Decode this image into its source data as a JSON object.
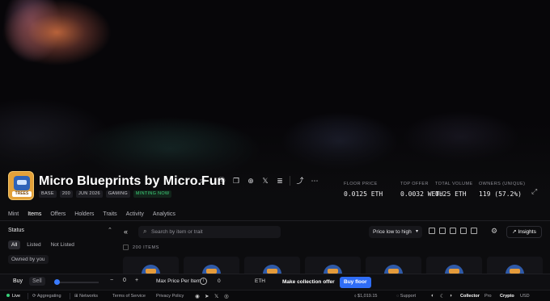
{
  "collection": {
    "title": "Micro Blueprints by Micro.Fun",
    "avatar_tag": "TREES",
    "badges": [
      "BASE",
      "200",
      "JUN 2026",
      "GAMING",
      "MINTING NOW"
    ]
  },
  "header_icons": [
    "star-icon",
    "info-icon",
    "copy-icon",
    "globe-icon",
    "x-icon",
    "stack-icon",
    "share-icon",
    "more-icon"
  ],
  "stats": [
    {
      "label": "FLOOR PRICE",
      "value": "0.0125 ETH"
    },
    {
      "label": "TOP OFFER",
      "value": "0.0032 WETH"
    },
    {
      "label": "TOTAL VOLUME",
      "value": "0.25 ETH"
    },
    {
      "label": "OWNERS (UNIQUE)",
      "value": "119 (57.2%)"
    }
  ],
  "tabs": [
    "Mint",
    "Items",
    "Offers",
    "Holders",
    "Traits",
    "Activity",
    "Analytics"
  ],
  "active_tab": "Items",
  "filters": {
    "status_label": "Status",
    "options": [
      "All",
      "Listed",
      "Not Listed"
    ],
    "owned_label": "Owned by you"
  },
  "toolbar": {
    "search_placeholder": "Search by item or trait",
    "sort_label": "Price low to high",
    "insights_label": "Insights"
  },
  "items_count": "200 ITEMS",
  "buy_bar": {
    "buy_label": "Buy",
    "sell_label": "Sell",
    "minus": "−",
    "qty": "0",
    "plus": "+",
    "max_price_label": "Max Price Per Item",
    "max_price_value": "0",
    "currency": "ETH",
    "offer_label": "Make collection offer",
    "floor_label": "Buy floor"
  },
  "footer": {
    "live": "Live",
    "aggregating": "Aggregating",
    "networks": "Networks",
    "terms": "Terms of Service",
    "privacy": "Privacy Policy",
    "eth_price": "$1,019.15",
    "support": "Support",
    "mode": "Collector",
    "mode_pro": "Pro",
    "crypto": "Crypto",
    "usd": "USD"
  },
  "colors": {
    "accent_blue": "#2f6df6",
    "mint_green": "#3fd37a",
    "background": "#0c0c0e"
  }
}
